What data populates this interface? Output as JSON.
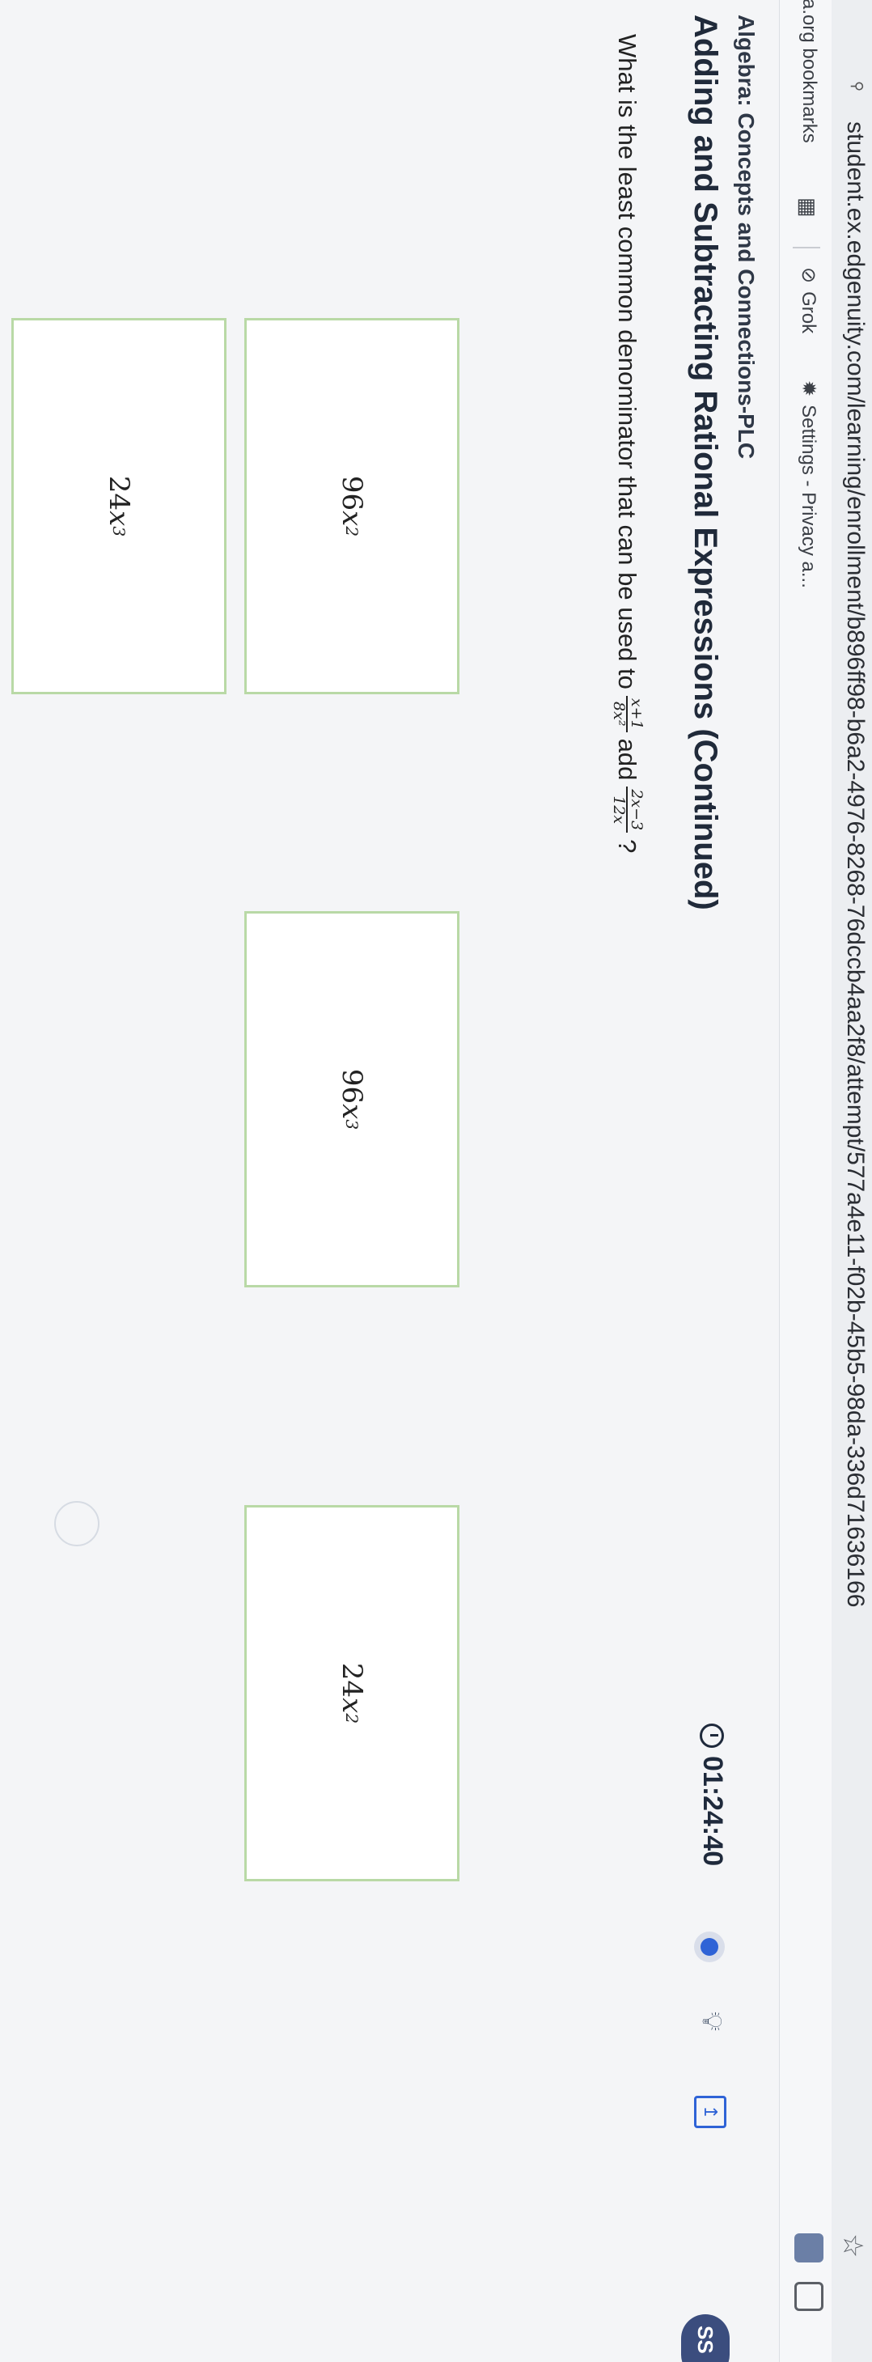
{
  "browser": {
    "url": "student.ex.edgenuity.com/learning/enrollment/b896ff98-b6a2-4976-8268-76dccb4aa2f8/attempt/577a4e11-f02b-45b5-98da-336d71636166",
    "bookmarks": [
      {
        "label": "a.org bookmarks"
      },
      {
        "label": "Grok",
        "icon": "grok-icon"
      },
      {
        "label": "Settings - Privacy a...",
        "icon": "gear-icon"
      }
    ]
  },
  "header": {
    "course": "Algebra: Concepts and Connections-PLC",
    "lesson": "Adding and Subtracting Rational Expressions (Continued)",
    "timer": "01:24:40",
    "badge": "SS"
  },
  "question": {
    "prefix": "What is the least common denominator that can be used to",
    "frac1": {
      "num": "x+1",
      "den": "8x²"
    },
    "middle": "add",
    "frac2": {
      "num": "2x−3",
      "den": "12x"
    },
    "suffix": "?"
  },
  "answers": [
    {
      "coef": "96",
      "var": "x",
      "exp": "2"
    },
    {
      "coef": "24",
      "var": "x",
      "exp": "3"
    },
    {
      "coef": "96",
      "var": "x",
      "exp": "3"
    },
    {
      "coef": "24",
      "var": "x",
      "exp": "2"
    }
  ],
  "colors": {
    "answer_border": "#b9d9a6",
    "accent": "#2f63d6",
    "badge": "#3b4d7e"
  }
}
